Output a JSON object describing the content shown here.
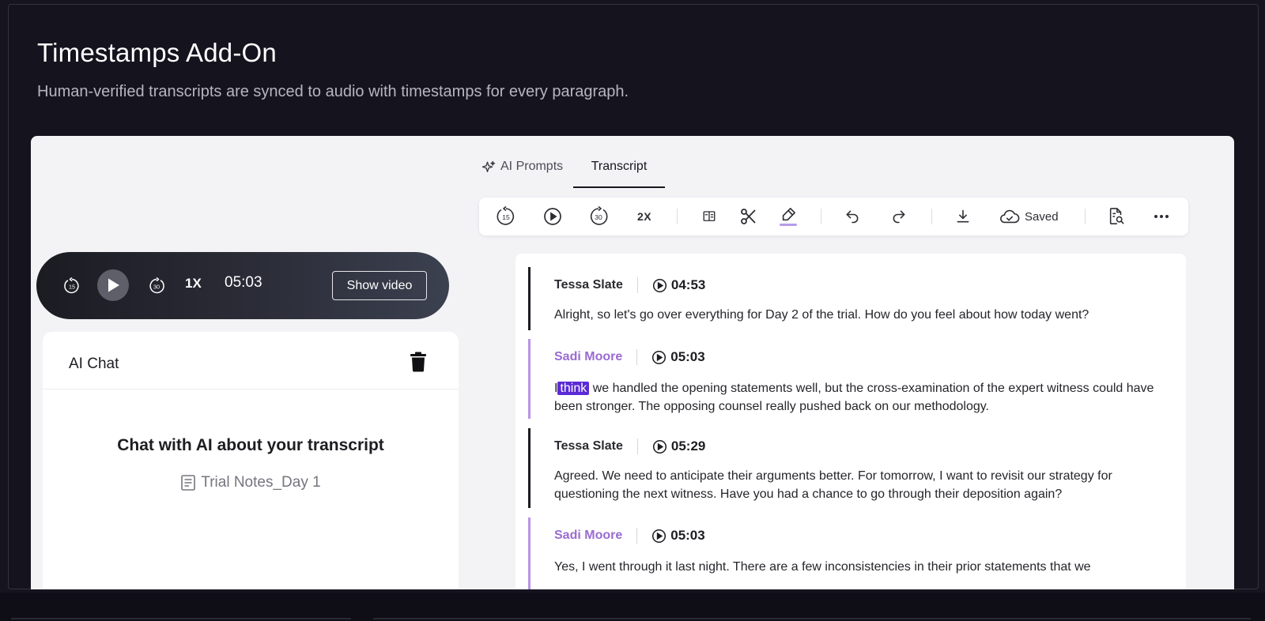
{
  "header": {
    "title": "Timestamps Add-On",
    "subtitle": "Human-verified transcripts are synced to audio with timestamps for every paragraph."
  },
  "tabs": {
    "ai_prompts": "AI Prompts",
    "transcript": "Transcript",
    "active": "Transcript"
  },
  "toolbar": {
    "rewind_seconds": "15",
    "forward_seconds": "30",
    "speed": "2X",
    "save_status": "Saved",
    "icons": [
      "rewind-15-icon",
      "play-icon",
      "forward-30-icon",
      "table-of-contents-icon",
      "scissors-icon",
      "highlighter-icon",
      "undo-icon",
      "redo-icon",
      "download-icon",
      "cloud-check-icon",
      "document-search-icon",
      "more-icon"
    ],
    "highlight_color": "#b79be8"
  },
  "player": {
    "rewind_seconds": "15",
    "forward_seconds": "30",
    "speed": "1X",
    "time": "05:03",
    "show_video_label": "Show video"
  },
  "chat": {
    "title": "AI Chat",
    "empty_title": "Chat with AI about your transcript",
    "file_name": "Trial Notes_Day 1"
  },
  "segments": [
    {
      "speaker": "Tessa Slate",
      "time": "04:53",
      "text": "Alright, so let's go over everything for Day 2 of the trial. How do you feel about how today went?"
    },
    {
      "speaker": "Sadi Moore",
      "time": "05:03",
      "text_before": "I",
      "highlight": "think",
      "text_after": "we handled the opening statements well, but the cross-examination of the expert witness could have been stronger. The opposing counsel really pushed back on our methodology."
    },
    {
      "speaker": "Tessa Slate",
      "time": "05:29",
      "text": "Agreed. We need to anticipate their arguments better. For tomorrow, I want to revisit our strategy for questioning the next witness. Have you had a chance to go through their deposition again?"
    },
    {
      "speaker": "Sadi Moore",
      "time": "05:03",
      "text": "Yes, I went through it last night. There are a few inconsistencies in their prior statements that we"
    }
  ],
  "colors": {
    "background": "#15141f",
    "speaker_a": "#2a2a30",
    "speaker_b": "#9a6bd0",
    "highlight": "#5b2ad6"
  }
}
